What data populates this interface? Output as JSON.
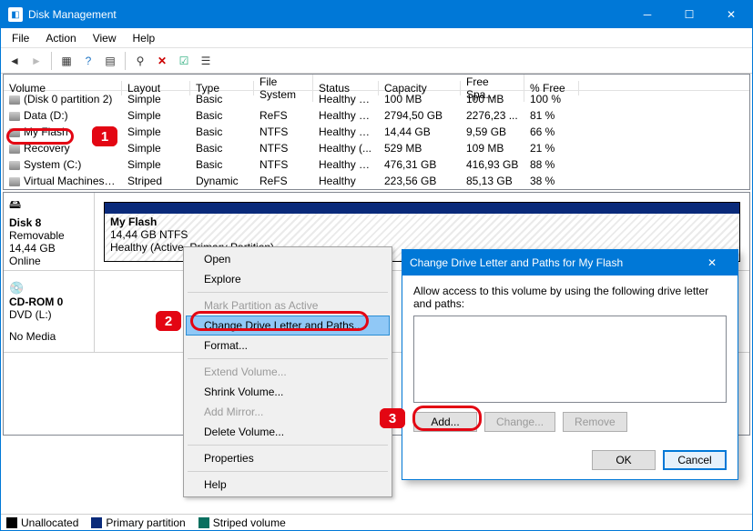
{
  "window": {
    "title": "Disk Management"
  },
  "menu": [
    "File",
    "Action",
    "View",
    "Help"
  ],
  "columns": [
    "Volume",
    "Layout",
    "Type",
    "File System",
    "Status",
    "Capacity",
    "Free Spa...",
    "% Free"
  ],
  "volumes": [
    {
      "name": "(Disk 0 partition 2)",
      "layout": "Simple",
      "type": "Basic",
      "fs": "",
      "status": "Healthy (E...",
      "cap": "100 MB",
      "free": "100 MB",
      "pct": "100 %"
    },
    {
      "name": "Data (D:)",
      "layout": "Simple",
      "type": "Basic",
      "fs": "ReFS",
      "status": "Healthy (P...",
      "cap": "2794,50 GB",
      "free": "2276,23 ...",
      "pct": "81 %"
    },
    {
      "name": "My Flash",
      "layout": "Simple",
      "type": "Basic",
      "fs": "NTFS",
      "status": "Healthy (A...",
      "cap": "14,44 GB",
      "free": "9,59 GB",
      "pct": "66 %"
    },
    {
      "name": "Recovery",
      "layout": "Simple",
      "type": "Basic",
      "fs": "NTFS",
      "status": "Healthy (...",
      "cap": "529 MB",
      "free": "109 MB",
      "pct": "21 %"
    },
    {
      "name": "System (C:)",
      "layout": "Simple",
      "type": "Basic",
      "fs": "NTFS",
      "status": "Healthy (B...",
      "cap": "476,31 GB",
      "free": "416,93 GB",
      "pct": "88 %"
    },
    {
      "name": "Virtual Machines (...",
      "layout": "Striped",
      "type": "Dynamic",
      "fs": "ReFS",
      "status": "Healthy",
      "cap": "223,56 GB",
      "free": "85,13 GB",
      "pct": "38 %"
    }
  ],
  "disk8": {
    "label": "Disk 8",
    "kind": "Removable",
    "size": "14,44 GB",
    "state": "Online",
    "part_name": "My Flash",
    "part_line2": "14,44 GB NTFS",
    "part_line3": "Healthy (Active, Primary Partition)"
  },
  "cdrom": {
    "label": "CD-ROM 0",
    "drive": "DVD (L:)",
    "nomedia": "No Media"
  },
  "legend": {
    "un": "Unallocated",
    "pp": "Primary partition",
    "sv": "Striped volume"
  },
  "ctx": {
    "open": "Open",
    "explore": "Explore",
    "mark": "Mark Partition as Active",
    "change": "Change Drive Letter and Paths...",
    "format": "Format...",
    "extend": "Extend Volume...",
    "shrink": "Shrink Volume...",
    "mirror": "Add Mirror...",
    "delete": "Delete Volume...",
    "props": "Properties",
    "help": "Help"
  },
  "dlg": {
    "title": "Change Drive Letter and Paths for My Flash",
    "desc": "Allow access to this volume by using the following drive letter and paths:",
    "add": "Add...",
    "change": "Change...",
    "remove": "Remove",
    "ok": "OK",
    "cancel": "Cancel"
  },
  "callouts": {
    "c1": "1",
    "c2": "2",
    "c3": "3"
  }
}
